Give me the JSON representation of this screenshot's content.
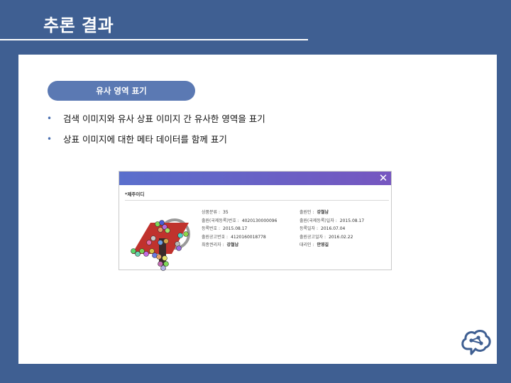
{
  "slide": {
    "title": "추론 결과"
  },
  "section": {
    "label": "유사 영역 표기"
  },
  "bullets": [
    "검색 이미지와 유사 상표 이미지 간 유사한 영역을 표기",
    "상표 이미지에 대한 메타 데이터를 함께 표기"
  ],
  "detail_window": {
    "close_icon": "close-icon",
    "mark_name": "*제주이디",
    "left_fields": [
      {
        "label": "상품분류 :",
        "value": "35",
        "bold": false
      },
      {
        "label": "출원(국제등록)번호 :",
        "value": "4020130000096",
        "bold": false
      },
      {
        "label": "등록번호 :",
        "value": "2015.08.17",
        "bold": false
      },
      {
        "label": "출원공고번호 :",
        "value": "4120160018778",
        "bold": false
      },
      {
        "label": "최종권리자 :",
        "value": "강철남",
        "bold": true
      }
    ],
    "right_fields": [
      {
        "label": "출원인 :",
        "value": "강철남",
        "bold": true
      },
      {
        "label": "출원(국제등록)일자 :",
        "value": "2015.08.17",
        "bold": false
      },
      {
        "label": "등록일자 :",
        "value": "2016.07.04",
        "bold": false
      },
      {
        "label": "출원공고일자 :",
        "value": "2016.02.22",
        "bold": false
      },
      {
        "label": "대리인 :",
        "value": "안영길",
        "bold": true
      }
    ]
  },
  "colors": {
    "background": "#3f5f92",
    "pill": "#5b79b3",
    "header_gradient_start": "#5a6fcc",
    "header_gradient_end": "#7656c0",
    "mark_red": "#c0322d"
  },
  "logo_icon": "brain-network-icon"
}
